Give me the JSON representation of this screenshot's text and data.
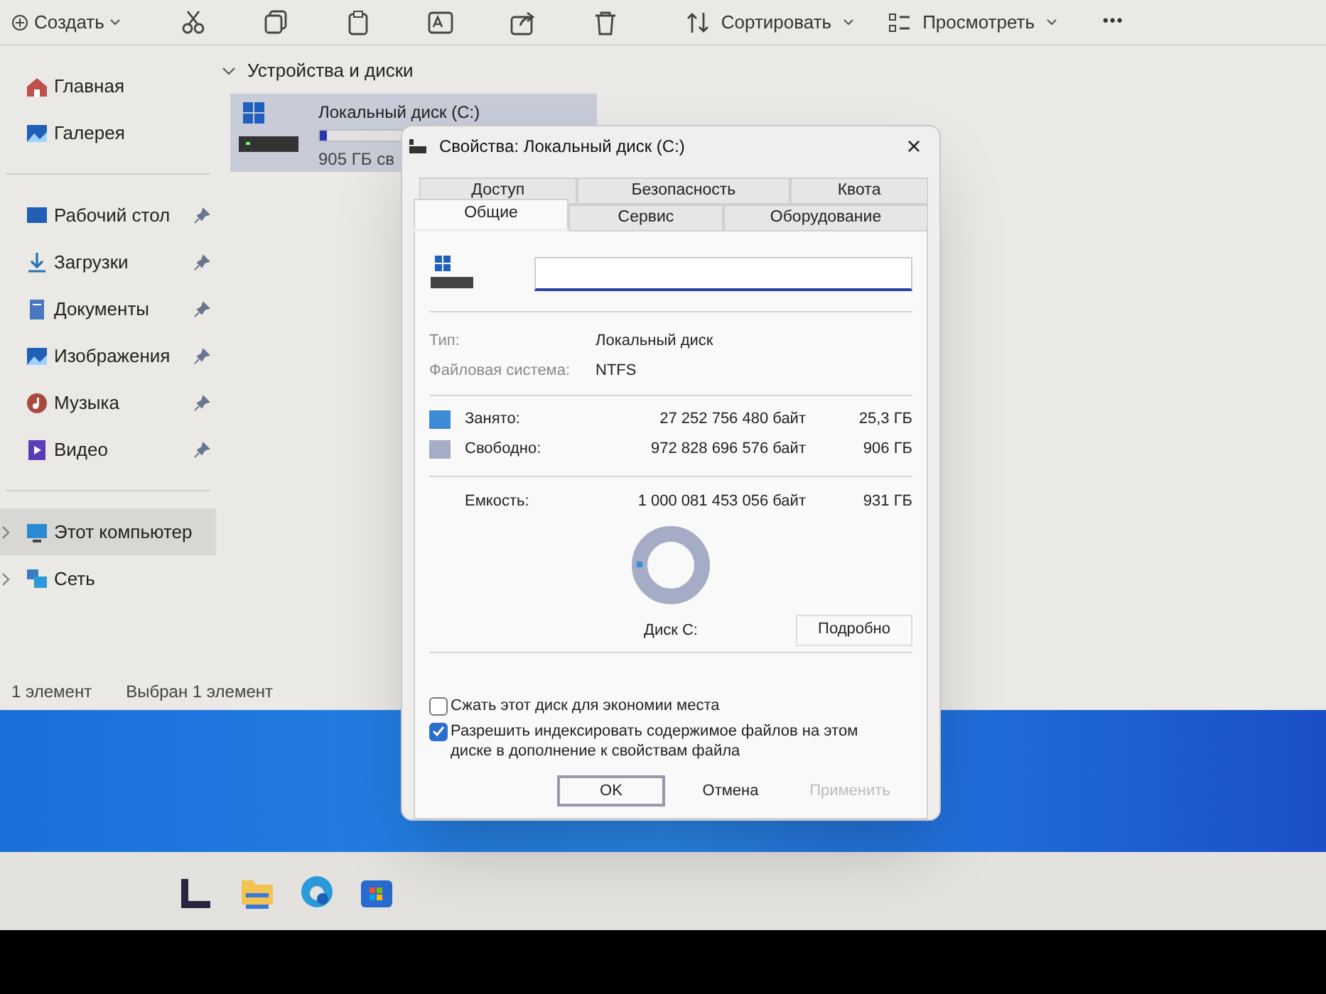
{
  "toolbar": {
    "create": "Создать",
    "sort": "Сортировать",
    "view": "Просмотреть",
    "more": "•••"
  },
  "sidebar": {
    "groups": [
      [
        {
          "label": "Главная",
          "pinned": false,
          "selected": false
        },
        {
          "label": "Галерея",
          "pinned": false,
          "selected": false
        }
      ],
      [
        {
          "label": "Рабочий стол",
          "pinned": true,
          "selected": false
        },
        {
          "label": "Загрузки",
          "pinned": true,
          "selected": false
        },
        {
          "label": "Документы",
          "pinned": true,
          "selected": false
        },
        {
          "label": "Изображения",
          "pinned": true,
          "selected": false
        },
        {
          "label": "Музыка",
          "pinned": true,
          "selected": false
        },
        {
          "label": "Видео",
          "pinned": true,
          "selected": false
        }
      ],
      [
        {
          "label": "Этот компьютер",
          "pinned": false,
          "selected": true,
          "expandable": true
        },
        {
          "label": "Сеть",
          "pinned": false,
          "selected": false,
          "expandable": true
        }
      ]
    ]
  },
  "content": {
    "section": "Устройства и диски",
    "drive": {
      "name": "Локальный диск (C:)",
      "free": "905 ГБ св",
      "level": 0.03,
      "selected": true
    }
  },
  "status_bar": [
    "1 элемент",
    "Выбран 1 элемент"
  ],
  "dialog": {
    "title": "Свойства: Локальный диск (C:)",
    "close": "×",
    "tab_rows": [
      [
        {
          "label": "Доступ",
          "selected": false
        },
        {
          "label": "Безопасность",
          "selected": false
        },
        {
          "label": "Квота",
          "selected": false
        }
      ],
      [
        {
          "label": "Общие",
          "selected": true
        },
        {
          "label": "Сервис",
          "selected": false
        },
        {
          "label": "Оборудование",
          "selected": false
        }
      ]
    ],
    "info": [
      {
        "label": "Тип:",
        "value": "Локальный диск"
      },
      {
        "label": "Файловая система:",
        "value": "NTFS"
      }
    ],
    "usage": [
      {
        "label": "Занято:",
        "bytes": "27 252 756 480 байт",
        "size": "25,3 ГБ",
        "color": "#3d8ad6"
      },
      {
        "label": "Свободно:",
        "bytes": "972 828 696 576 байт",
        "size": "906 ГБ",
        "color": "#a4acc6"
      }
    ],
    "capacity": {
      "label": "Емкость:",
      "bytes": "1 000 081 453 056 байт",
      "size": "931 ГБ"
    },
    "chart_label": "Диск C:",
    "details_button": "Подробно",
    "options": [
      {
        "label": "Сжать этот диск для экономии места",
        "checked": false
      },
      {
        "label": "Разрешить индексировать содержимое файлов на этом диске в дополнение к свойствам файла",
        "checked": true
      }
    ],
    "buttons": [
      {
        "label": "OK",
        "kind": "default",
        "disabled": false
      },
      {
        "label": "Отмена",
        "kind": "normal",
        "disabled": false
      },
      {
        "label": "Применить",
        "kind": "normal",
        "disabled": true
      }
    ]
  }
}
